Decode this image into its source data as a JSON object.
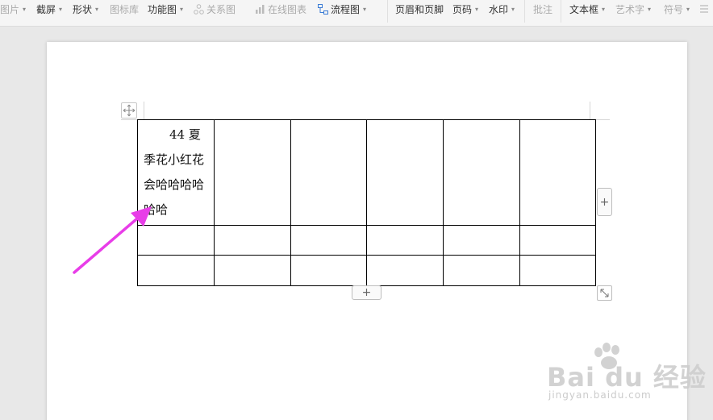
{
  "toolbar": {
    "items": [
      {
        "label": "图片",
        "icon": "",
        "caret": true,
        "disabled": true
      },
      {
        "label": "截屏",
        "icon": "",
        "caret": true,
        "disabled": false
      },
      {
        "label": "形状",
        "icon": "",
        "caret": true,
        "disabled": false
      },
      {
        "label": "图标库",
        "icon": "",
        "caret": false,
        "disabled": true
      },
      {
        "label": "功能图",
        "icon": "",
        "caret": true,
        "disabled": false
      },
      {
        "label": "关系图",
        "icon": "relation-icon",
        "caret": false,
        "disabled": true
      },
      {
        "label": "在线图表",
        "icon": "chart-icon",
        "caret": false,
        "disabled": true
      },
      {
        "label": "流程图",
        "icon": "flowchart-icon",
        "caret": true,
        "disabled": false
      },
      {
        "label": "页眉和页脚",
        "icon": "",
        "caret": false,
        "disabled": false
      },
      {
        "label": "页码",
        "icon": "",
        "caret": true,
        "disabled": false
      },
      {
        "label": "水印",
        "icon": "",
        "caret": true,
        "disabled": false
      },
      {
        "label": "批注",
        "icon": "",
        "caret": false,
        "disabled": true
      },
      {
        "label": "文本框",
        "icon": "",
        "caret": true,
        "disabled": false
      },
      {
        "label": "艺术字",
        "icon": "",
        "caret": true,
        "disabled": true
      },
      {
        "label": "符号",
        "icon": "",
        "caret": true,
        "disabled": true
      }
    ]
  },
  "document": {
    "cell_text_line1": "44 夏",
    "cell_text_rest": "季花小红花会哈哈哈哈哈哈"
  },
  "controls": {
    "add_column": "+",
    "add_row": "+"
  },
  "watermark": {
    "logo": "Bai du 经验",
    "url": "jingyan.baidu.com"
  },
  "colors": {
    "arrow": "#e83de8",
    "toolbar_bg": "#f5f5f5",
    "workspace_bg": "#e8e8e8"
  }
}
